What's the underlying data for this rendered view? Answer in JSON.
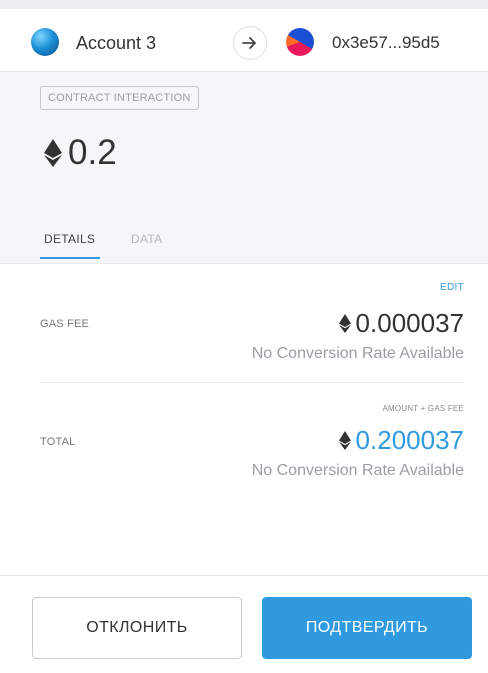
{
  "header": {
    "from_account": "Account 3",
    "to_address": "0x3e57...95d5",
    "arrow_icon": "arrow-right-icon"
  },
  "summary": {
    "method_badge": "CONTRACT INTERACTION",
    "amount": "0.2",
    "currency_icon": "eth-icon"
  },
  "tabs": {
    "details": "DETAILS",
    "data": "DATA",
    "active": "details"
  },
  "details": {
    "edit_label": "EDIT",
    "gas_fee": {
      "label": "GAS FEE",
      "value": "0.000037",
      "conversion": "No Conversion Rate Available"
    },
    "total": {
      "caption": "AMOUNT + GAS FEE",
      "label": "TOTAL",
      "value": "0.200037",
      "conversion": "No Conversion Rate Available"
    }
  },
  "footer": {
    "reject_label": "ОТКЛОНИТЬ",
    "confirm_label": "ПОДТВЕРДИТЬ"
  },
  "colors": {
    "accent": "#2f9ae0",
    "summary_bg": "#f4f6f8",
    "text": "#333333",
    "muted": "#9a9ea3"
  }
}
